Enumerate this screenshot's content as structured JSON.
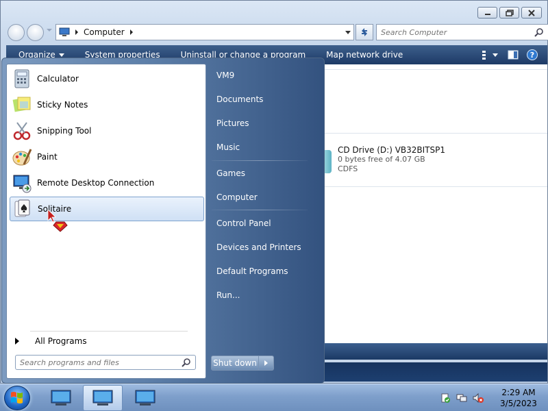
{
  "window": {
    "caption_buttons": [
      "minimize-icon",
      "maximize-icon",
      "close-icon"
    ]
  },
  "address_bar": {
    "location": "Computer",
    "icon": "computer-icon"
  },
  "search": {
    "placeholder": "Search Computer"
  },
  "toolbar": {
    "organize": "Organize",
    "system_properties": "System properties",
    "uninstall": "Uninstall or change a program",
    "map_network_drive": "Map network drive"
  },
  "content": {
    "drive": {
      "name": "CD Drive (D:) VB32BITSP1",
      "free": "0 bytes free of 4.07 GB",
      "filesystem": "CDFS"
    }
  },
  "start_menu": {
    "programs": [
      {
        "label": "Calculator",
        "icon": "calculator-icon"
      },
      {
        "label": "Sticky Notes",
        "icon": "sticky-notes-icon"
      },
      {
        "label": "Snipping Tool",
        "icon": "scissors-icon"
      },
      {
        "label": "Paint",
        "icon": "palette-icon"
      },
      {
        "label": "Remote Desktop Connection",
        "icon": "monitor-icon"
      },
      {
        "label": "Solitaire",
        "icon": "playing-card-icon",
        "selected": true
      }
    ],
    "all_programs": "All Programs",
    "search_placeholder": "Search programs and files",
    "right_items": [
      "VM9",
      "Documents",
      "Pictures",
      "Music",
      "Games",
      "Computer",
      "Control Panel",
      "Devices and Printers",
      "Default Programs",
      "Run..."
    ],
    "shutdown": "Shut down"
  },
  "taskbar": {
    "pinned": [
      "monitor-icon",
      "monitor-icon",
      "monitor-icon"
    ],
    "tray_icons": [
      "action-center-icon",
      "network-icon",
      "volume-muted-icon"
    ],
    "time": "2:29 AM",
    "date": "3/5/2023"
  }
}
